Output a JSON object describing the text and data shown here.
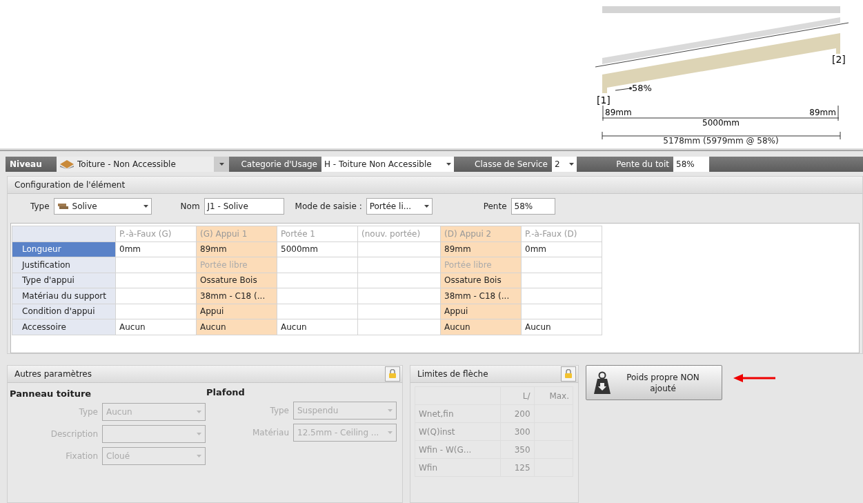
{
  "diagram": {
    "slope_label": "58%",
    "support_left": "[1]",
    "support_right": "[2]",
    "left_bearing": "89mm",
    "span": "5000mm",
    "right_bearing": "89mm",
    "total": "5178mm (5979mm @ 58%)"
  },
  "toolbar": {
    "niveau_label": "Niveau",
    "niveau_value": "Toiture - Non Accessible",
    "usage_label": "Categorie d'Usage",
    "usage_value": "H - Toiture Non Accessible",
    "service_label": "Classe de Service",
    "service_value": "2",
    "pente_label": "Pente du toit",
    "pente_value": "58%"
  },
  "config": {
    "title": "Configuration de l'élément",
    "type_label": "Type",
    "type_value": "Solive",
    "nom_label": "Nom",
    "nom_value": "J1 - Solive",
    "mode_label": "Mode de saisie :",
    "mode_value": "Portée li...",
    "pente_label": "Pente",
    "pente_value": "58%"
  },
  "grid": {
    "columns": [
      {
        "label": "P.-à-Faux (G)",
        "highlighted": false
      },
      {
        "label": "(G) Appui 1",
        "highlighted": true
      },
      {
        "label": "Portée 1",
        "highlighted": false
      },
      {
        "label": "(nouv. portée)",
        "highlighted": false
      },
      {
        "label": "(D) Appui 2",
        "highlighted": true
      },
      {
        "label": "P.-à-Faux (D)",
        "highlighted": false
      }
    ],
    "rows": [
      {
        "label": "Longueur",
        "selected": true,
        "cells": [
          {
            "text": "0mm",
            "muted": false
          },
          {
            "text": "89mm",
            "muted": false
          },
          {
            "text": "5000mm",
            "muted": false
          },
          {
            "text": "",
            "muted": false
          },
          {
            "text": "89mm",
            "muted": false
          },
          {
            "text": "0mm",
            "muted": false
          }
        ]
      },
      {
        "label": "Justification",
        "selected": false,
        "cells": [
          {
            "text": "",
            "muted": false
          },
          {
            "text": "Portée libre",
            "muted": true
          },
          {
            "text": "",
            "muted": false
          },
          {
            "text": "",
            "muted": false
          },
          {
            "text": "Portée libre",
            "muted": true
          },
          {
            "text": "",
            "muted": false
          }
        ]
      },
      {
        "label": "Type d'appui",
        "selected": false,
        "cells": [
          {
            "text": "",
            "muted": false
          },
          {
            "text": "Ossature Bois",
            "muted": false
          },
          {
            "text": "",
            "muted": false
          },
          {
            "text": "",
            "muted": false
          },
          {
            "text": "Ossature Bois",
            "muted": false
          },
          {
            "text": "",
            "muted": false
          }
        ]
      },
      {
        "label": "Matériau du support",
        "selected": false,
        "cells": [
          {
            "text": "",
            "muted": false
          },
          {
            "text": "38mm - C18 (...",
            "muted": false
          },
          {
            "text": "",
            "muted": false
          },
          {
            "text": "",
            "muted": false
          },
          {
            "text": "38mm - C18 (...",
            "muted": false
          },
          {
            "text": "",
            "muted": false
          }
        ]
      },
      {
        "label": "Condition d'appui",
        "selected": false,
        "cells": [
          {
            "text": "",
            "muted": false
          },
          {
            "text": "Appui",
            "muted": false
          },
          {
            "text": "",
            "muted": false
          },
          {
            "text": "",
            "muted": false
          },
          {
            "text": "Appui",
            "muted": false
          },
          {
            "text": "",
            "muted": false
          }
        ]
      },
      {
        "label": "Accessoire",
        "selected": false,
        "cells": [
          {
            "text": "Aucun",
            "muted": false
          },
          {
            "text": "Aucun",
            "muted": false
          },
          {
            "text": "Aucun",
            "muted": false
          },
          {
            "text": "",
            "muted": false
          },
          {
            "text": "Aucun",
            "muted": false
          },
          {
            "text": "Aucun",
            "muted": false
          }
        ]
      }
    ]
  },
  "autres": {
    "title": "Autres paramètres",
    "groups": [
      {
        "title": "Panneau toiture",
        "fields": [
          {
            "label": "Type",
            "value": "Aucun",
            "disabled": true
          },
          {
            "label": "Description",
            "disabled": true
          },
          {
            "label": "Fixation",
            "value": "Cloué",
            "disabled": true
          }
        ]
      },
      {
        "title": "Plafond",
        "fields": [
          {
            "label": "Type",
            "value": "Suspendu",
            "disabled": true
          },
          {
            "label": "Matériau",
            "value": "12.5mm - Ceiling ...",
            "disabled": true
          }
        ]
      }
    ]
  },
  "limites": {
    "title": "Limites de flèche",
    "headers": [
      "L/",
      "Max."
    ],
    "rows": [
      {
        "name": "Wnet,fin",
        "value": "200"
      },
      {
        "name": "W(Q)inst",
        "value": "300"
      },
      {
        "name": "Wfin - W(G...",
        "value": "350"
      },
      {
        "name": "Wfin",
        "value": "125"
      }
    ]
  },
  "self_weight_button": "Poids propre NON\najouté"
}
